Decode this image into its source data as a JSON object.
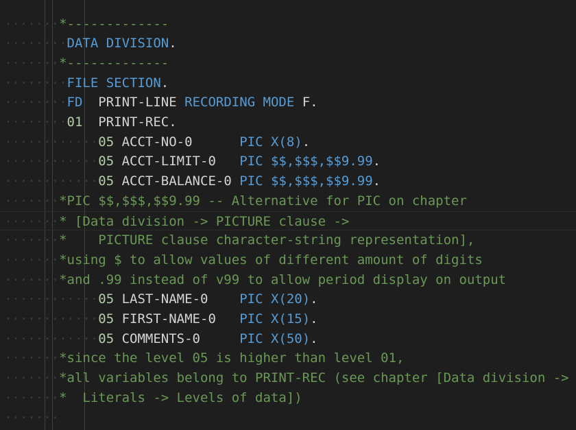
{
  "lines": [
    [
      {
        "c": "lead",
        "t": "·······"
      },
      {
        "c": "cmt",
        "t": "*-------------"
      }
    ],
    [
      {
        "c": "lead",
        "t": "········"
      },
      {
        "c": "kw",
        "t": "DATA DIVISION"
      },
      {
        "c": "id",
        "t": "."
      }
    ],
    [
      {
        "c": "lead",
        "t": "·······"
      },
      {
        "c": "cmt",
        "t": "*-------------"
      }
    ],
    [
      {
        "c": "lead",
        "t": "········"
      },
      {
        "c": "kw",
        "t": "FILE SECTION"
      },
      {
        "c": "id",
        "t": "."
      }
    ],
    [
      {
        "c": "lead",
        "t": "········"
      },
      {
        "c": "kw",
        "t": "FD"
      },
      {
        "c": "id",
        "t": "  PRINT-LINE "
      },
      {
        "c": "kw",
        "t": "RECORDING MODE"
      },
      {
        "c": "id",
        "t": " F."
      }
    ],
    [
      {
        "c": "lead",
        "t": "········"
      },
      {
        "c": "num",
        "t": "01"
      },
      {
        "c": "id",
        "t": "  PRINT-REC."
      }
    ],
    [
      {
        "c": "lead",
        "t": "············"
      },
      {
        "c": "num",
        "t": "05"
      },
      {
        "c": "id",
        "t": " ACCT-NO-0      "
      },
      {
        "c": "kw",
        "t": "PIC X(8)"
      },
      {
        "c": "id",
        "t": "."
      }
    ],
    [
      {
        "c": "lead",
        "t": "············"
      },
      {
        "c": "num",
        "t": "05"
      },
      {
        "c": "id",
        "t": " ACCT-LIMIT-0   "
      },
      {
        "c": "kw",
        "t": "PIC $$,$$$,$$9.99"
      },
      {
        "c": "id",
        "t": "."
      }
    ],
    [
      {
        "c": "lead",
        "t": "············"
      },
      {
        "c": "num",
        "t": "05"
      },
      {
        "c": "id",
        "t": " ACCT-BALANCE-0 "
      },
      {
        "c": "kw",
        "t": "PIC $$,$$$,$$9.99"
      },
      {
        "c": "id",
        "t": "."
      }
    ],
    [
      {
        "c": "lead",
        "t": "·······"
      },
      {
        "c": "cmt",
        "t": "*PIC $$,$$$,$$9.99 -- Alternative for PIC on chapter"
      }
    ],
    [
      {
        "c": "lead",
        "t": "·······"
      },
      {
        "c": "cmt",
        "t": "* [Data division -> PICTURE clause ->"
      }
    ],
    [
      {
        "c": "lead",
        "t": "·······"
      },
      {
        "c": "cmt",
        "t": "*    PICTURE clause character-string representation],"
      }
    ],
    [
      {
        "c": "lead",
        "t": "·······"
      },
      {
        "c": "cmt",
        "t": "*using $ to allow values of different amount of digits"
      }
    ],
    [
      {
        "c": "lead",
        "t": "·······"
      },
      {
        "c": "cmt",
        "t": "*and .99 instead of v99 to allow period display on output"
      }
    ],
    [
      {
        "c": "lead",
        "t": "············"
      },
      {
        "c": "num",
        "t": "05"
      },
      {
        "c": "id",
        "t": " LAST-NAME-0    "
      },
      {
        "c": "kw",
        "t": "PIC X(20)"
      },
      {
        "c": "id",
        "t": "."
      }
    ],
    [
      {
        "c": "lead",
        "t": "············"
      },
      {
        "c": "num",
        "t": "05"
      },
      {
        "c": "id",
        "t": " FIRST-NAME-0   "
      },
      {
        "c": "kw",
        "t": "PIC X(15)"
      },
      {
        "c": "id",
        "t": "."
      }
    ],
    [
      {
        "c": "lead",
        "t": "············"
      },
      {
        "c": "num",
        "t": "05"
      },
      {
        "c": "id",
        "t": " COMMENTS-0     "
      },
      {
        "c": "kw",
        "t": "PIC X(50)"
      },
      {
        "c": "id",
        "t": "."
      }
    ],
    [
      {
        "c": "lead",
        "t": "·······"
      },
      {
        "c": "cmt",
        "t": "*since the level 05 is higher than level 01,"
      }
    ],
    [
      {
        "c": "lead",
        "t": "·······"
      },
      {
        "c": "cmt",
        "t": "*all variables belong to PRINT-REC (see chapter [Data division ->"
      }
    ],
    [
      {
        "c": "lead",
        "t": "·······"
      },
      {
        "c": "cmt",
        "t": "*  Literals -> Levels of data])"
      }
    ],
    [
      {
        "c": "lead",
        "t": "·······"
      }
    ]
  ],
  "current_line": 10
}
